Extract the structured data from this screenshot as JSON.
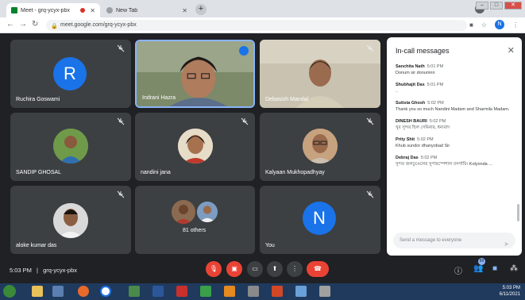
{
  "browser": {
    "tabs": [
      {
        "title": "Meet - grq-ycyx-pbx",
        "active": true
      },
      {
        "title": "New Tab",
        "active": false
      }
    ],
    "url": "meet.google.com/grq-ycyx-pbx",
    "profile_initial": "N"
  },
  "colors": {
    "meet_bg": "#202124",
    "tile_bg": "#3c4043",
    "accent_blue": "#1a73e8",
    "red": "#ea4335"
  },
  "tiles": [
    {
      "name": "Ruchira Goswami",
      "avatar_letter": "R",
      "avatar_color": "#1a73e8"
    },
    {
      "name": "Indrani Hazra"
    },
    {
      "name": "Debasish Mandal"
    },
    {
      "name": "SANDIP GHOSAL"
    },
    {
      "name": "nandini jana"
    },
    {
      "name": "Kalyaan Mukhopadhyay"
    },
    {
      "name": "aloke kumar das"
    },
    {
      "name": "81 others"
    },
    {
      "name": "You",
      "avatar_letter": "N",
      "avatar_color": "#1a73e8"
    }
  ],
  "chat": {
    "title": "In-call messages",
    "messages": [
      {
        "sender": "Sanchita Nath",
        "time": "5:01 PM",
        "text": "Donum sir donumnn"
      },
      {
        "sender": "Shubhajit Das",
        "time": "5:01 PM",
        "text": ".."
      },
      {
        "sender": "Sutista Ghosh",
        "time": "5:02 PM",
        "text": "Thank you so much Nandini Madam and Sharmila Madam."
      },
      {
        "sender": "DINESH BAURI",
        "time": "5:02 PM",
        "text": "খুব সুন্দর ছিল সেমিনার, ধন্যবাদ"
      },
      {
        "sender": "Prity Shit",
        "time": "5:02 PM",
        "text": "Khub sundor dhanyobad Sir"
      },
      {
        "sender": "Debraj Das",
        "time": "5:02 PM",
        "text": "সুন্দর জলঢুঙেলের সুপারস্পেশাল বসর্গারি। Kolyonda ..."
      }
    ],
    "input_placeholder": "Send a message to everyone"
  },
  "bottom": {
    "time": "5:03 PM",
    "separator": "|",
    "meeting_code": "grq-ycyx-pbx",
    "participant_badge": "89"
  },
  "taskbar": {
    "clock_time": "5:03 PM",
    "clock_date": "6/11/2021"
  }
}
